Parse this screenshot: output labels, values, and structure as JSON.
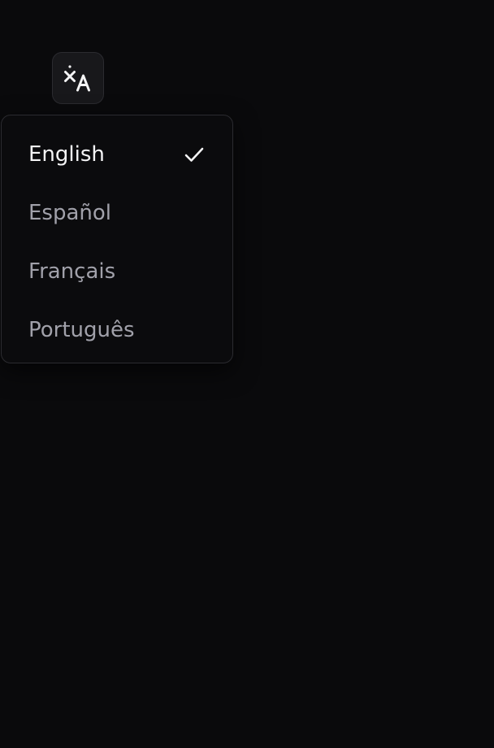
{
  "language_button": {
    "icon": "translate-icon"
  },
  "language_menu": {
    "selected_icon": "check-icon",
    "items": [
      {
        "label": "English",
        "selected": true
      },
      {
        "label": "Español",
        "selected": false
      },
      {
        "label": "Français",
        "selected": false
      },
      {
        "label": "Português",
        "selected": false
      }
    ]
  },
  "colors": {
    "background": "#0a0a0c",
    "menu_border": "#2b2b30",
    "selected_text": "#f4f4f5",
    "muted_text": "#a1a1aa"
  }
}
